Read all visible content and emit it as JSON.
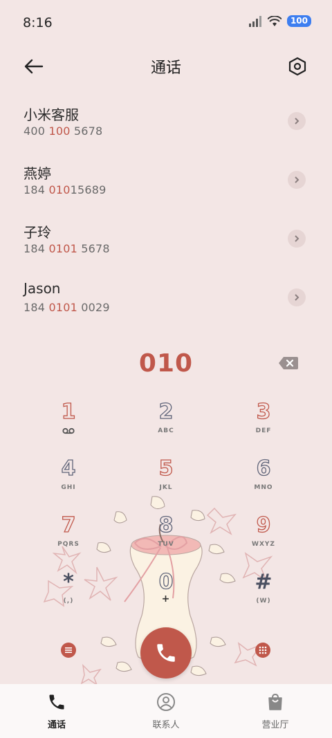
{
  "status": {
    "time": "8:16",
    "battery": "100"
  },
  "header": {
    "title": "通话"
  },
  "contacts": [
    {
      "name": "小米客服",
      "number_pre": "400 ",
      "number_hl": "100",
      "number_post": " 5678"
    },
    {
      "name": "燕婷",
      "number_pre": "184 ",
      "number_hl": "010",
      "number_post": "15689"
    },
    {
      "name": "子玲",
      "number_pre": "184 ",
      "number_hl": "0101",
      "number_post": " 5678"
    },
    {
      "name": "Jason",
      "number_pre": "184 ",
      "number_hl": "0101",
      "number_post": " 0029"
    }
  ],
  "dialer": {
    "input": "010"
  },
  "keypad": [
    {
      "digit": "1",
      "letters": ""
    },
    {
      "digit": "2",
      "letters": "ABC"
    },
    {
      "digit": "3",
      "letters": "DEF"
    },
    {
      "digit": "4",
      "letters": "GHI"
    },
    {
      "digit": "5",
      "letters": "JKL"
    },
    {
      "digit": "6",
      "letters": "MNO"
    },
    {
      "digit": "7",
      "letters": "PQRS"
    },
    {
      "digit": "8",
      "letters": "TUV"
    },
    {
      "digit": "9",
      "letters": "WXYZ"
    },
    {
      "digit": "*",
      "letters": "(,)"
    },
    {
      "digit": "0",
      "letters": "+"
    },
    {
      "digit": "#",
      "letters": "(W)"
    }
  ],
  "tabs": [
    {
      "label": "通话"
    },
    {
      "label": "联系人"
    },
    {
      "label": "营业厅"
    }
  ],
  "colors": {
    "accent": "#c0584b",
    "background": "#f3e6e5",
    "key_gray": "#60657a"
  },
  "icons": {
    "back": "arrow-left-icon",
    "settings": "hexagon-gear-icon",
    "backspace": "backspace-icon",
    "call": "phone-icon",
    "menu": "menu-icon",
    "dialpad": "dialpad-icon",
    "voicemail": "voicemail-icon",
    "contacts": "person-icon",
    "store": "shopping-bag-icon"
  }
}
